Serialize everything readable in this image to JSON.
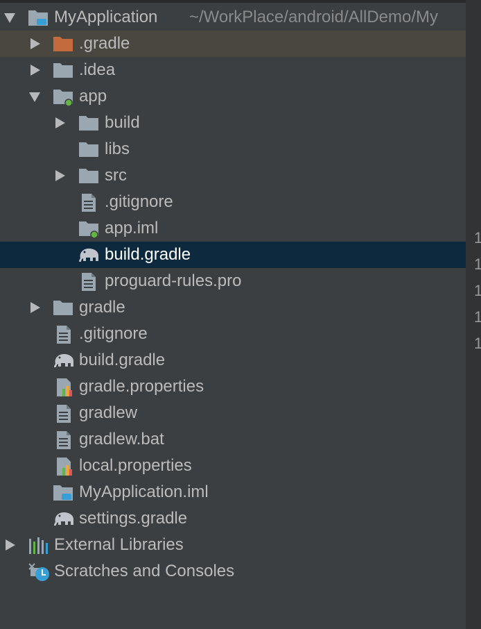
{
  "project": {
    "name": "MyApplication",
    "path": "~/WorkPlace/android/AllDemo/My"
  },
  "items": [
    {
      "label": ".gradle",
      "icon": "folder-orange-icon",
      "expanded": false
    },
    {
      "label": ".idea",
      "icon": "folder-icon",
      "expanded": false
    },
    {
      "label": "app",
      "icon": "module-folder-icon",
      "expanded": true
    },
    {
      "label": "build",
      "icon": "folder-icon",
      "expanded": false
    },
    {
      "label": "libs",
      "icon": "folder-icon"
    },
    {
      "label": "src",
      "icon": "folder-icon",
      "expanded": false
    },
    {
      "label": ".gitignore",
      "icon": "text-file-icon"
    },
    {
      "label": "app.iml",
      "icon": "iml-module-icon"
    },
    {
      "label": "build.gradle",
      "icon": "gradle-elephant-icon",
      "selected": true
    },
    {
      "label": "proguard-rules.pro",
      "icon": "text-file-icon"
    },
    {
      "label": "gradle",
      "icon": "folder-icon",
      "expanded": false
    },
    {
      "label": ".gitignore",
      "icon": "text-file-icon"
    },
    {
      "label": "build.gradle",
      "icon": "gradle-elephant-icon"
    },
    {
      "label": "gradle.properties",
      "icon": "properties-file-icon"
    },
    {
      "label": "gradlew",
      "icon": "text-file-icon"
    },
    {
      "label": "gradlew.bat",
      "icon": "text-file-icon"
    },
    {
      "label": "local.properties",
      "icon": "properties-file-icon"
    },
    {
      "label": "MyApplication.iml",
      "icon": "iml-project-icon"
    },
    {
      "label": "settings.gradle",
      "icon": "gradle-elephant-icon"
    }
  ],
  "external_libraries": {
    "label": "External Libraries",
    "icon": "library-bars-icon"
  },
  "scratches": {
    "label": "Scratches and Consoles",
    "icon": "scratches-clock-icon"
  },
  "gutter_digits": [
    "1",
    "1",
    "1",
    "1",
    "1"
  ],
  "colors": {
    "background": "#3c3f41",
    "selection": "#0d293e",
    "highlight": "#4a4640",
    "folder": "#9aa7b0",
    "folder_orange": "#c36b3c",
    "module_dot": "#62b543",
    "badge_blue": "#389fd6"
  }
}
